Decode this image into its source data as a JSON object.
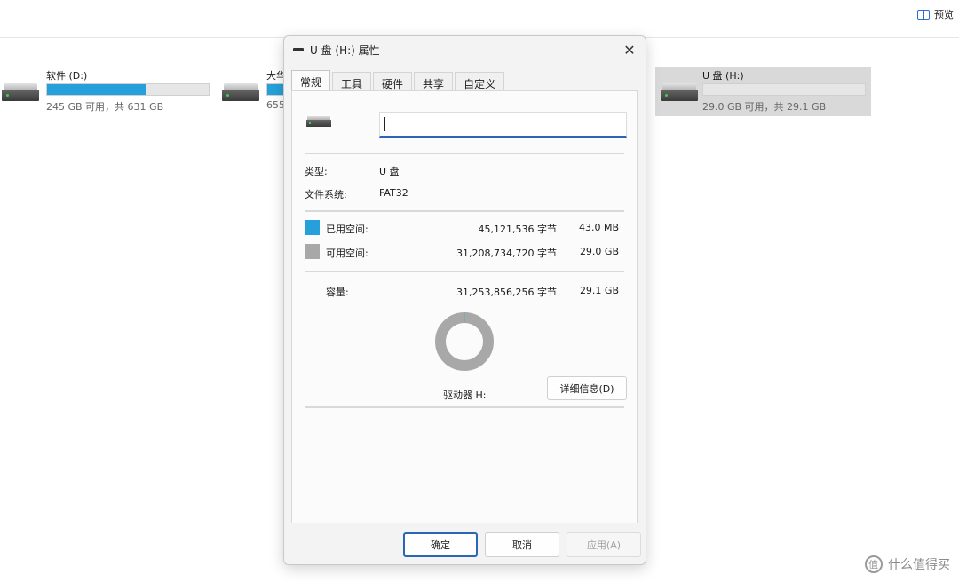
{
  "toolbar": {
    "preview_label": "预览"
  },
  "drives": [
    {
      "name": "软件 (D:)",
      "free_text": "245 GB 可用，共 631 GB",
      "used_fraction": 0.61
    },
    {
      "name": "大华",
      "free_text": "655",
      "used_fraction": 0.5
    },
    {
      "name": "U 盘 (H:)",
      "free_text": "29.0 GB 可用，共 29.1 GB",
      "used_fraction": 0.0
    }
  ],
  "dialog": {
    "title": "U 盘 (H:) 属性",
    "tabs": [
      {
        "label": "常规",
        "active": true
      },
      {
        "label": "工具"
      },
      {
        "label": "硬件"
      },
      {
        "label": "共享"
      },
      {
        "label": "自定义"
      }
    ],
    "volume_label_value": "",
    "type_label": "类型:",
    "type_value": "U 盘",
    "fs_label": "文件系统:",
    "fs_value": "FAT32",
    "used": {
      "label": "已用空间:",
      "bytes": "45,121,536 字节",
      "size": "43.0 MB",
      "color": "#26a0da"
    },
    "free": {
      "label": "可用空间:",
      "bytes": "31,208,734,720 字节",
      "size": "29.0 GB",
      "color": "#a8a8a8"
    },
    "capacity": {
      "label": "容量:",
      "bytes": "31,253,856,256 字节",
      "size": "29.1 GB"
    },
    "used_fraction": 0.0014,
    "drive_caption": "驱动器 H:",
    "details_button": "详细信息(D)",
    "ok_button": "确定",
    "cancel_button": "取消",
    "apply_button": "应用(A)"
  },
  "watermark": "什么值得买"
}
